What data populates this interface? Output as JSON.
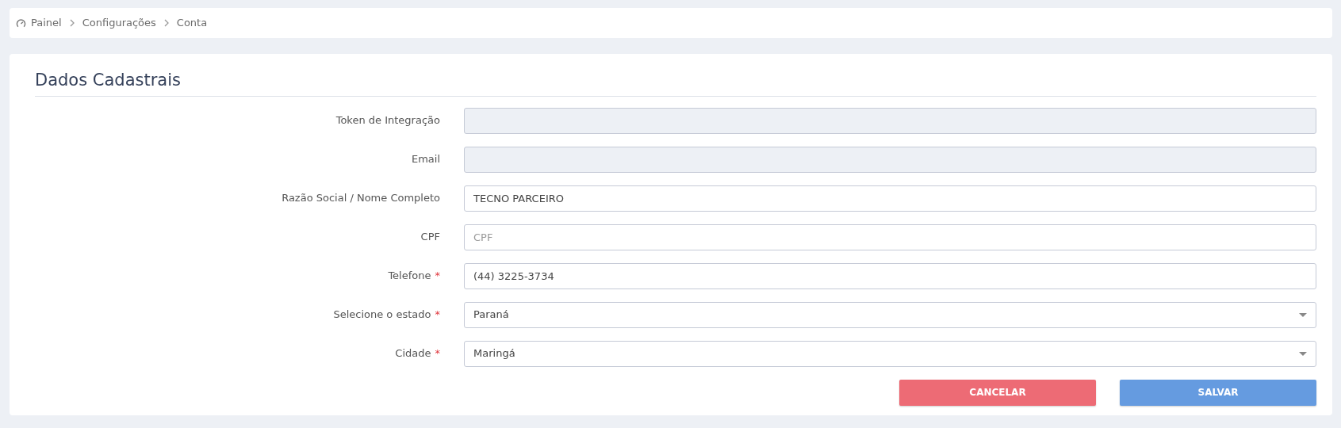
{
  "breadcrumb": [
    {
      "label": "Painel",
      "kind": "home"
    },
    {
      "label": "Configurações",
      "kind": "page"
    },
    {
      "label": "Conta",
      "kind": "page"
    }
  ],
  "form": {
    "title": "Dados Cadastrais",
    "fields": [
      {
        "label": "Token de Integração",
        "kind": "input",
        "disabled": true,
        "required": false
      },
      {
        "label": "Email",
        "kind": "input",
        "disabled": true,
        "required": false
      },
      {
        "label": "Razão Social / Nome Completo",
        "kind": "input",
        "disabled": false,
        "required": false,
        "value": "TECNO PARCEIRO"
      },
      {
        "label": "CPF",
        "kind": "input",
        "disabled": false,
        "required": false,
        "placeholder": "CPF"
      },
      {
        "label": "Telefone",
        "kind": "input",
        "disabled": false,
        "required": true,
        "required_mark": "*",
        "value": "(44) 3225-3734"
      },
      {
        "label": "Selecione o estado",
        "kind": "select",
        "disabled": false,
        "required": true,
        "required_mark": "*",
        "value": "Paraná"
      },
      {
        "label": "Cidade",
        "kind": "select",
        "disabled": false,
        "required": true,
        "required_mark": "*",
        "value": "Maringá"
      }
    ],
    "buttons": [
      {
        "label": "CANCELAR",
        "kind": "cancel"
      },
      {
        "label": "SALVAR",
        "kind": "save"
      }
    ]
  }
}
